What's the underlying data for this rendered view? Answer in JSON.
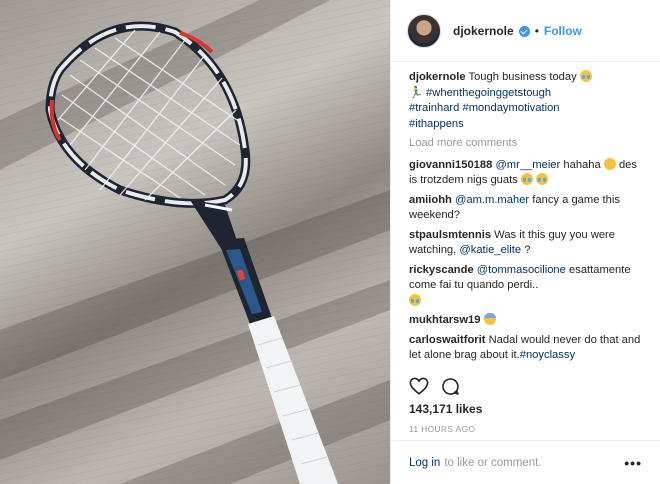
{
  "header": {
    "username": "djokernole",
    "separator": "•",
    "follow_label": "Follow"
  },
  "caption": {
    "username": "djokernole",
    "text": "Tough business today",
    "line2_prefix": "🏃‍♂️",
    "tags": [
      "#whenthegoinggetstough",
      "#trainhard",
      "#mondaymotivation",
      "#ithappens"
    ]
  },
  "load_more": "Load more comments",
  "comments": [
    {
      "user": "giovanni150188",
      "mention": "@mr__meier",
      "text": " hahaha ",
      "text2": "des is trotzdem nigs guats "
    },
    {
      "user": "amiiohh",
      "mention": "@am.m.maher",
      "text": " fancy a game this weekend?"
    },
    {
      "user": "stpaulsmtennis",
      "text": " Was it this guy you were watching, ",
      "mention": "@katie_elite",
      "text2": " ?"
    },
    {
      "user": "rickyscande",
      "mention": "@tommasocilione",
      "text": " esattamente come fai tu quando perdi.."
    },
    {
      "user": "mukhtarsw19",
      "text": " "
    },
    {
      "user": "carloswaitforit",
      "text": " Nadal would never do that and let alone brag about it.",
      "tag": "#noyclassy"
    }
  ],
  "likes": "143,171 likes",
  "time": "11 HOURS AGO",
  "footer": {
    "login": "Log in",
    "rest": "to like or comment.",
    "more": "•••"
  },
  "icons": {
    "like": "heart-outline-icon",
    "comment": "comment-bubble-icon"
  },
  "colors": {
    "link": "#003569",
    "follow": "#3897f0",
    "muted": "#999999"
  }
}
